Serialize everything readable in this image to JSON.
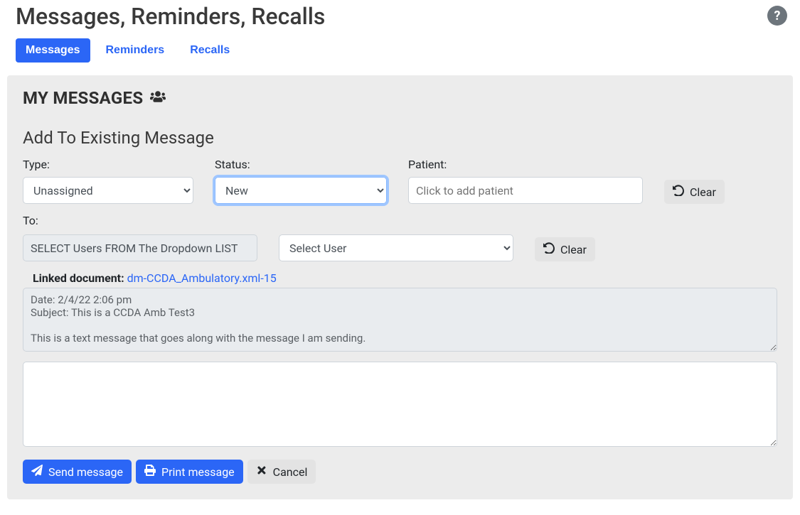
{
  "header": {
    "title": "Messages, Reminders, Recalls"
  },
  "tabs": [
    {
      "label": "Messages",
      "active": true
    },
    {
      "label": "Reminders",
      "active": false
    },
    {
      "label": "Recalls",
      "active": false
    }
  ],
  "section": {
    "title": "MY MESSAGES",
    "subtitle": "Add To Existing Message"
  },
  "form": {
    "type_label": "Type:",
    "type_value": "Unassigned",
    "status_label": "Status:",
    "status_value": "New",
    "patient_label": "Patient:",
    "patient_placeholder": "Click to add patient",
    "clear_label": "Clear",
    "to_label": "To:",
    "to_value": "SELECT Users FROM The Dropdown LIST",
    "user_select_value": "Select User",
    "linked_doc_label": "Linked document:",
    "linked_doc_name": "dm-CCDA_Ambulatory.xml-15",
    "message_display": "Date: 2/4/22 2:06 pm\nSubject: This is a CCDA Amb Test3\n\nThis is a text message that goes along with the message I am sending.",
    "compose_value": ""
  },
  "actions": {
    "send": "Send message",
    "print": "Print message",
    "cancel": "Cancel"
  }
}
